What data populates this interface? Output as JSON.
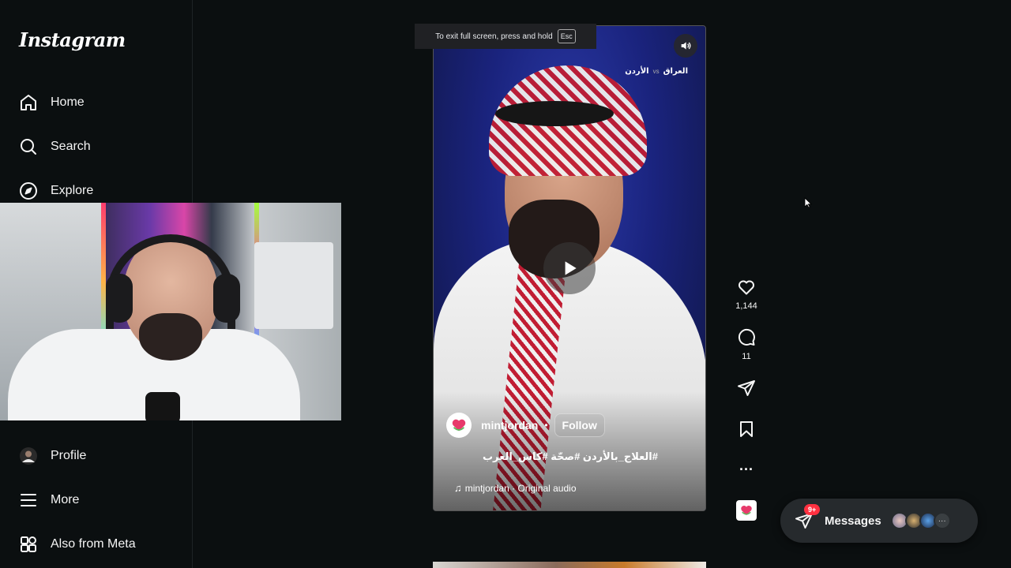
{
  "app": {
    "logo": "Instagram"
  },
  "sidebar": {
    "items": [
      {
        "label": "Home",
        "icon": "home-icon"
      },
      {
        "label": "Search",
        "icon": "search-icon"
      },
      {
        "label": "Explore",
        "icon": "compass-icon"
      },
      {
        "label": "Profile",
        "icon": "avatar"
      },
      {
        "label": "More",
        "icon": "menu-icon"
      },
      {
        "label": "Also from Meta",
        "icon": "grid-icon"
      }
    ]
  },
  "fullscreen_tip": {
    "text": "To exit full screen, press and hold",
    "key": "Esc"
  },
  "reel": {
    "match_badge": {
      "team_a": "الأردن",
      "vs": "vs",
      "team_b": "العراق"
    },
    "author": "mintjordan",
    "separator": "•",
    "follow_label": "Follow",
    "caption": "#العلاج_بالأردن #صحّة #كاس_العرب",
    "audio": "mintjordan · Original audio"
  },
  "actions": {
    "likes": "1,144",
    "comments": "11",
    "more": "..."
  },
  "messages": {
    "label": "Messages",
    "badge": "9+",
    "more": "···"
  },
  "colors": {
    "background": "#0b0f10",
    "badge": "#ff3040",
    "pill": "#262a2d"
  }
}
